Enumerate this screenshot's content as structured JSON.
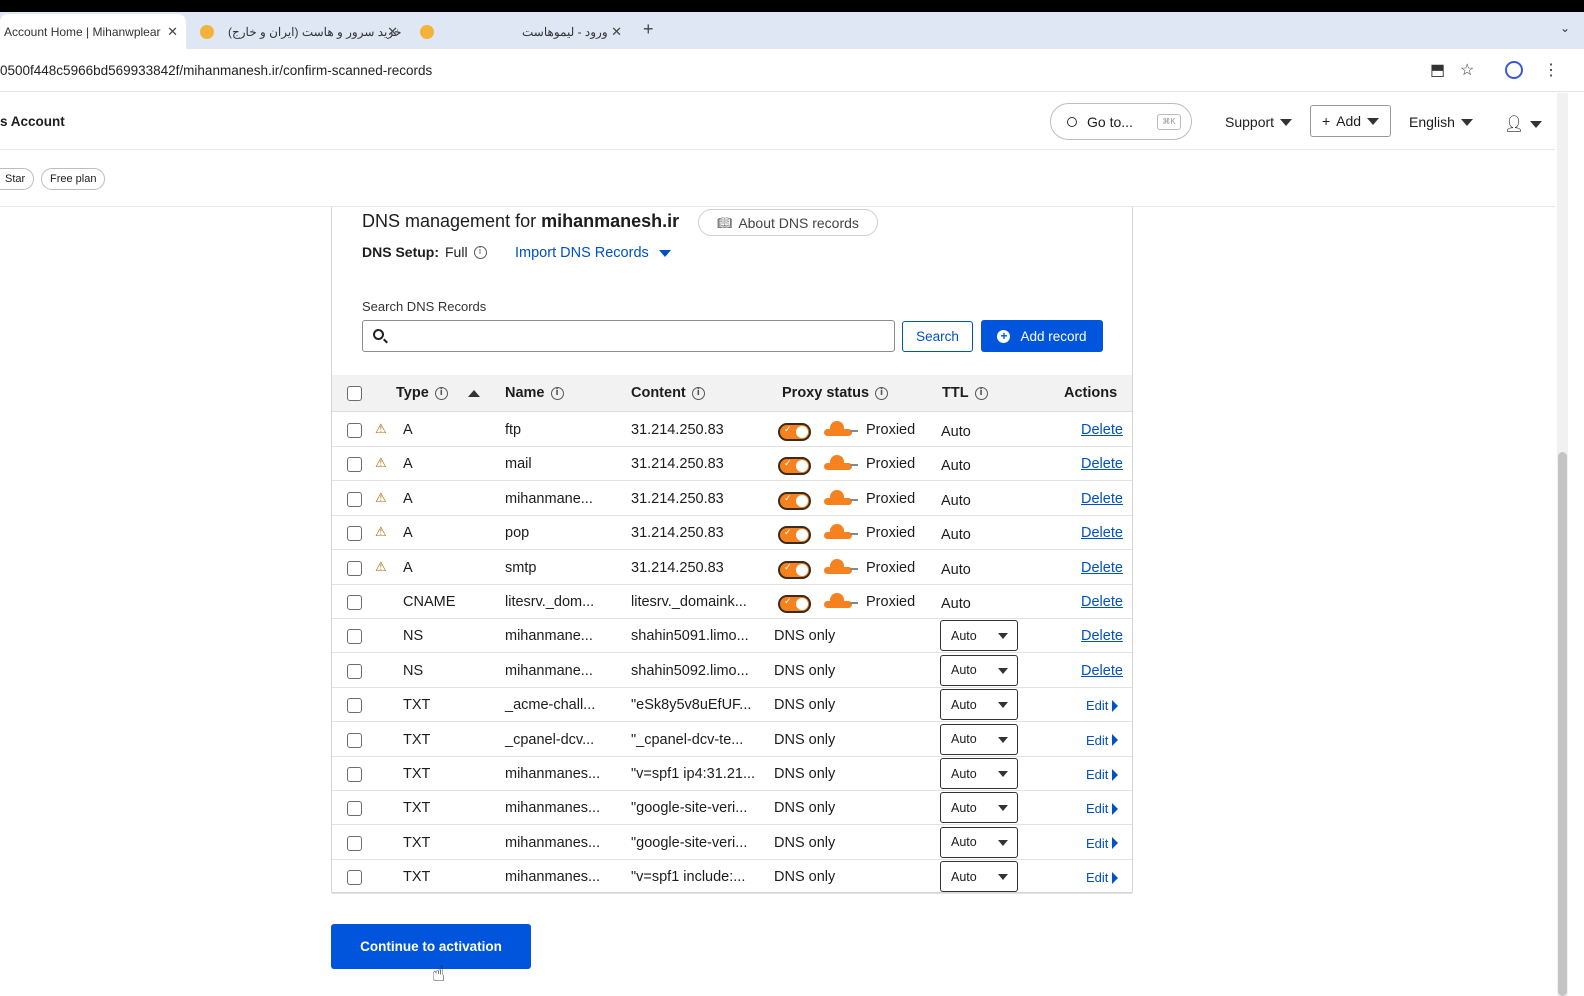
{
  "browser": {
    "tabs": [
      {
        "title": "Account Home | Mihanwplear",
        "active": true
      },
      {
        "title": "خرید سرور و هاست (ایران و خارج)",
        "active": false
      },
      {
        "title": "ورود - لیموهاست",
        "active": false
      }
    ],
    "url": "0500f448c5966bd569933842f/mihanmanesh.ir/confirm-scanned-records"
  },
  "header": {
    "account_title": "s Account",
    "goto_label": "Go to...",
    "goto_shortcut": "⌘K",
    "support_label": "Support",
    "add_label": "Add",
    "language_label": "English"
  },
  "subheader": {
    "pills": [
      "Star",
      "Free plan"
    ]
  },
  "dns": {
    "title_prefix": "DNS management for",
    "domain": "mihanmanesh.ir",
    "about_label": "About DNS records",
    "setup_label": "DNS Setup:",
    "setup_value": "Full",
    "import_label": "Import DNS Records",
    "search_label": "Search DNS Records",
    "search_placeholder": "",
    "search_button": "Search",
    "add_record_button": "Add record",
    "columns": {
      "type": "Type",
      "name": "Name",
      "content": "Content",
      "proxy": "Proxy status",
      "ttl": "TTL",
      "actions": "Actions"
    },
    "records": [
      {
        "type": "A",
        "name": "ftp",
        "content": "31.214.250.83",
        "proxy": "Proxied",
        "ttl": "Auto",
        "action": "Delete",
        "warning": true
      },
      {
        "type": "A",
        "name": "mail",
        "content": "31.214.250.83",
        "proxy": "Proxied",
        "ttl": "Auto",
        "action": "Delete",
        "warning": true
      },
      {
        "type": "A",
        "name": "mihanmane...",
        "content": "31.214.250.83",
        "proxy": "Proxied",
        "ttl": "Auto",
        "action": "Delete",
        "warning": true
      },
      {
        "type": "A",
        "name": "pop",
        "content": "31.214.250.83",
        "proxy": "Proxied",
        "ttl": "Auto",
        "action": "Delete",
        "warning": true
      },
      {
        "type": "A",
        "name": "smtp",
        "content": "31.214.250.83",
        "proxy": "Proxied",
        "ttl": "Auto",
        "action": "Delete",
        "warning": true
      },
      {
        "type": "CNAME",
        "name": "litesrv._dom...",
        "content": "litesrv._domaink...",
        "proxy": "Proxied",
        "ttl": "Auto",
        "action": "Delete",
        "warning": false
      },
      {
        "type": "NS",
        "name": "mihanmane...",
        "content": "shahin5091.limo...",
        "proxy": "DNS only",
        "ttl": "Auto",
        "action": "Delete",
        "warning": false
      },
      {
        "type": "NS",
        "name": "mihanmane...",
        "content": "shahin5092.limo...",
        "proxy": "DNS only",
        "ttl": "Auto",
        "action": "Delete",
        "warning": false
      },
      {
        "type": "TXT",
        "name": "_acme-chall...",
        "content": "\"eSk8y5v8uEfUF...",
        "proxy": "DNS only",
        "ttl": "Auto",
        "action": "Edit",
        "warning": false
      },
      {
        "type": "TXT",
        "name": "_cpanel-dcv...",
        "content": "\"_cpanel-dcv-te...",
        "proxy": "DNS only",
        "ttl": "Auto",
        "action": "Edit",
        "warning": false
      },
      {
        "type": "TXT",
        "name": "mihanmanes...",
        "content": "\"v=spf1 ip4:31.21...",
        "proxy": "DNS only",
        "ttl": "Auto",
        "action": "Edit",
        "warning": false
      },
      {
        "type": "TXT",
        "name": "mihanmanes...",
        "content": "\"google-site-veri...",
        "proxy": "DNS only",
        "ttl": "Auto",
        "action": "Edit",
        "warning": false
      },
      {
        "type": "TXT",
        "name": "mihanmanes...",
        "content": "\"google-site-veri...",
        "proxy": "DNS only",
        "ttl": "Auto",
        "action": "Edit",
        "warning": false
      },
      {
        "type": "TXT",
        "name": "mihanmanes...",
        "content": "\"v=spf1 include:...",
        "proxy": "DNS only",
        "ttl": "Auto",
        "action": "Edit",
        "warning": false
      }
    ],
    "continue_button": "Continue to activation"
  },
  "colors": {
    "accent": "#0055dc",
    "link": "#0051c3",
    "proxy_orange": "#f6821f"
  }
}
